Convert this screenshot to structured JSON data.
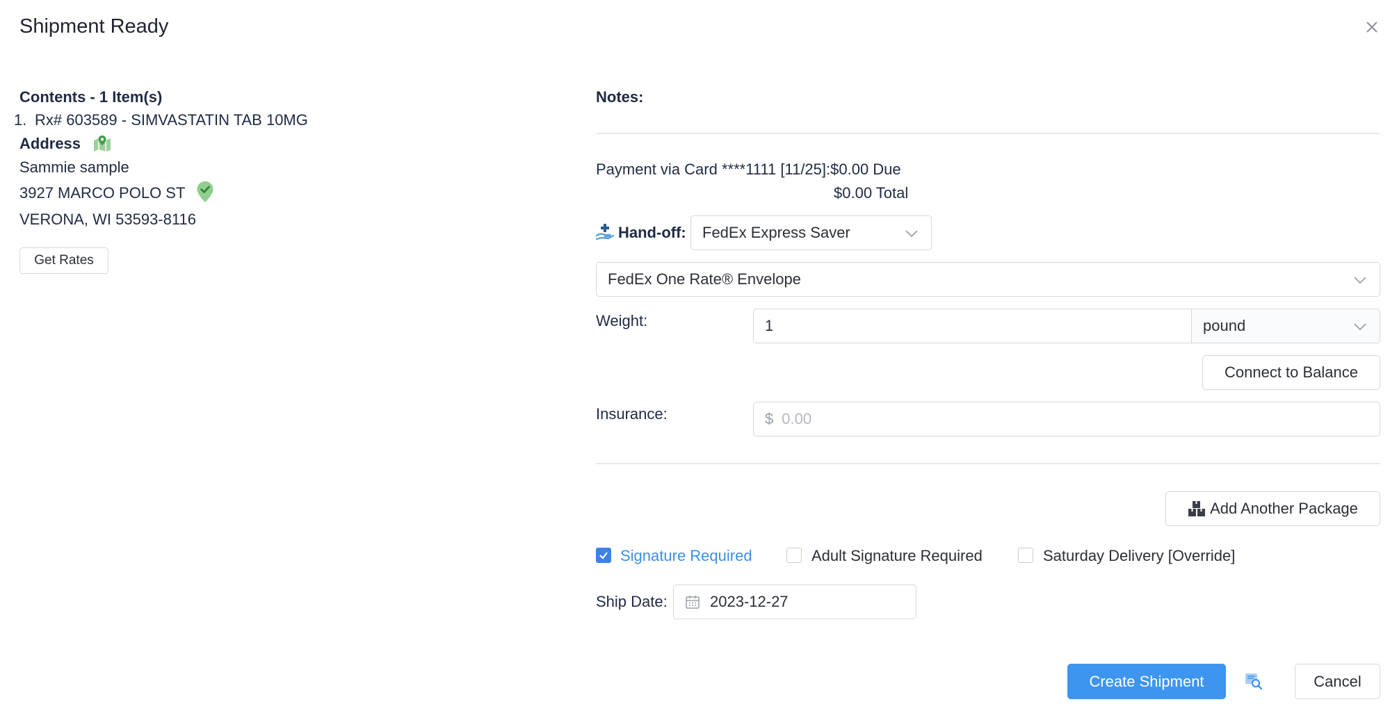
{
  "modal": {
    "title": "Shipment Ready"
  },
  "left": {
    "contents_heading": "Contents - 1 Item(s)",
    "items": [
      {
        "number": "1.",
        "text": "Rx# 603589 - SIMVASTATIN TAB 10MG"
      }
    ],
    "address_heading": "Address",
    "address_lines": [
      "Sammie sample",
      "3927 MARCO POLO ST",
      "VERONA, WI 53593-8116"
    ],
    "get_rates_label": "Get Rates"
  },
  "right": {
    "notes_label": "Notes:",
    "payment_line": "Payment via Card ****1111 [11/25]:$0.00 Due",
    "total_line": "$0.00 Total",
    "handoff_label": "Hand-off:",
    "handoff_value": "FedEx Express Saver",
    "package_type_value": "FedEx One Rate® Envelope",
    "weight_label": "Weight:",
    "weight_value": "1",
    "weight_unit": "pound",
    "connect_balance_label": "Connect to Balance",
    "insurance_label": "Insurance:",
    "insurance_prefix": "$",
    "insurance_placeholder": "0.00",
    "add_package_label": "Add Another Package",
    "options": [
      {
        "label": "Signature Required",
        "checked": true
      },
      {
        "label": "Adult Signature Required",
        "checked": false
      },
      {
        "label": "Saturday Delivery [Override]",
        "checked": false
      }
    ],
    "ship_date_label": "Ship Date:",
    "ship_date_value": "2023-12-27"
  },
  "footer": {
    "create_label": "Create Shipment",
    "cancel_label": "Cancel"
  },
  "icons": {
    "close": "close-icon",
    "map": "map-pin-icon",
    "verified": "verified-check-icon",
    "handoff": "hand-package-icon",
    "packages": "boxes-icon",
    "calendar": "calendar-icon",
    "preview": "label-preview-icon",
    "chevron": "chevron-down-icon"
  },
  "colors": {
    "primary": "#3d95f0",
    "link": "#3b8fe8",
    "success": "#5cb85c"
  }
}
